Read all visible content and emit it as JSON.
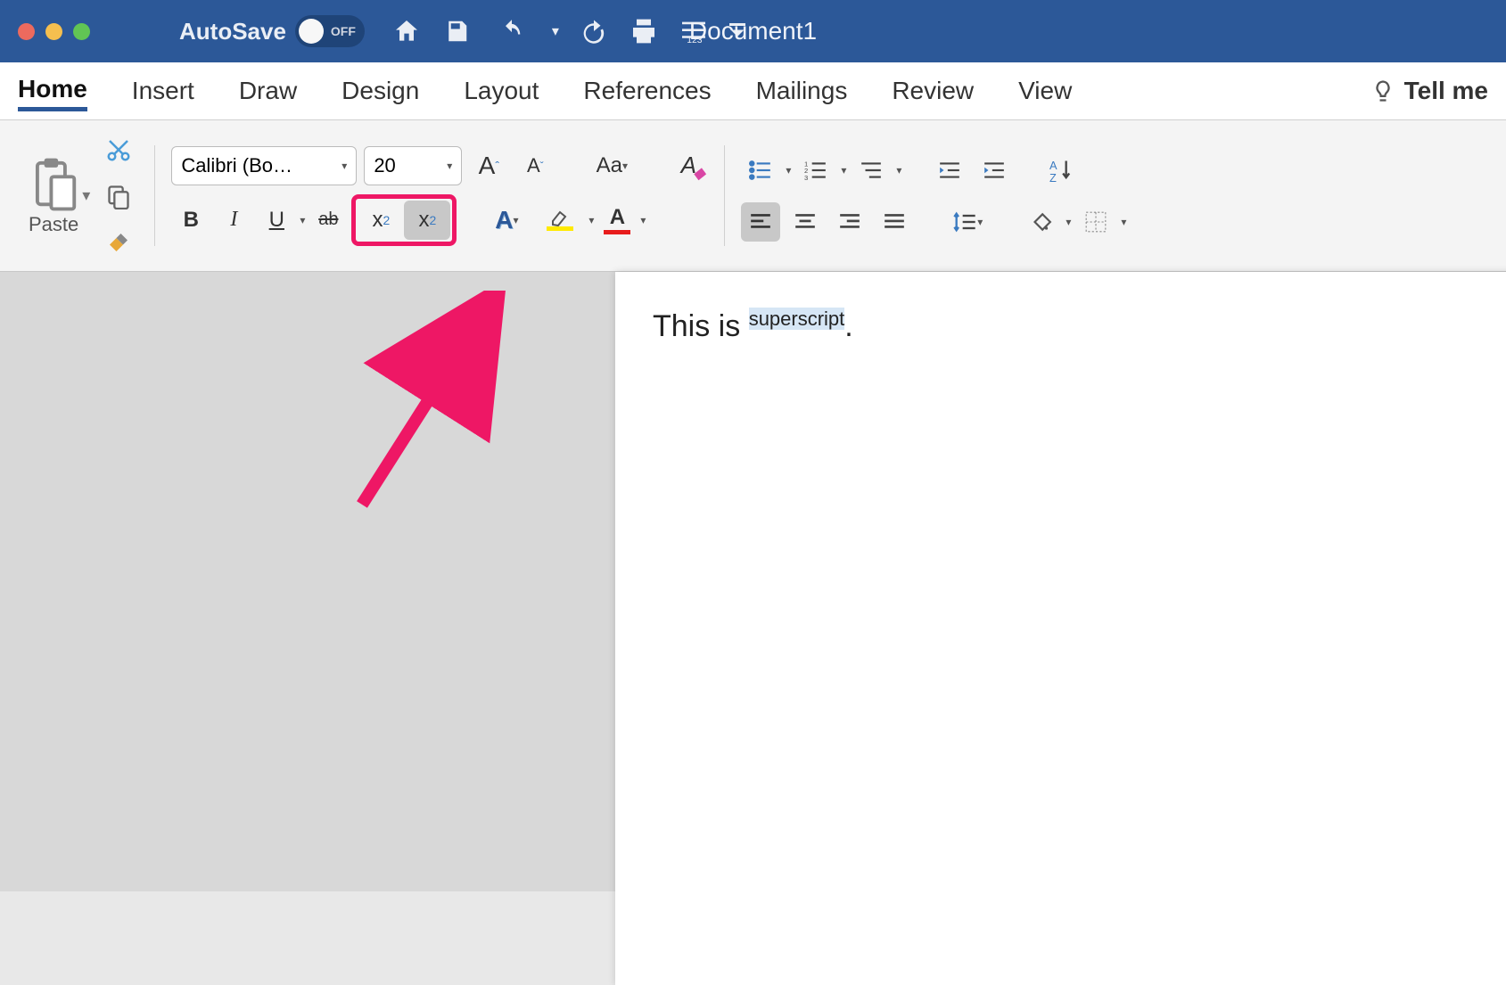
{
  "title_bar": {
    "autosave_label": "AutoSave",
    "autosave_state": "OFF",
    "document_title": "Document1"
  },
  "ribbon_tabs": [
    "Home",
    "Insert",
    "Draw",
    "Design",
    "Layout",
    "References",
    "Mailings",
    "Review",
    "View"
  ],
  "tell_me_label": "Tell me",
  "active_tab": "Home",
  "font": {
    "name": "Calibri (Bo…",
    "size": "20"
  },
  "clipboard": {
    "paste_label": "Paste"
  },
  "format_buttons": {
    "bold": "B",
    "italic": "I",
    "underline": "U",
    "strikethrough": "ab",
    "subscript": "x",
    "subscript_sub": "2",
    "superscript": "x",
    "superscript_sup": "2"
  },
  "document_content": {
    "prefix": "This is ",
    "highlighted": "superscript",
    "suffix": "."
  },
  "annotation": {
    "highlights": "subscript and superscript buttons",
    "arrow_color": "#ee1765"
  }
}
